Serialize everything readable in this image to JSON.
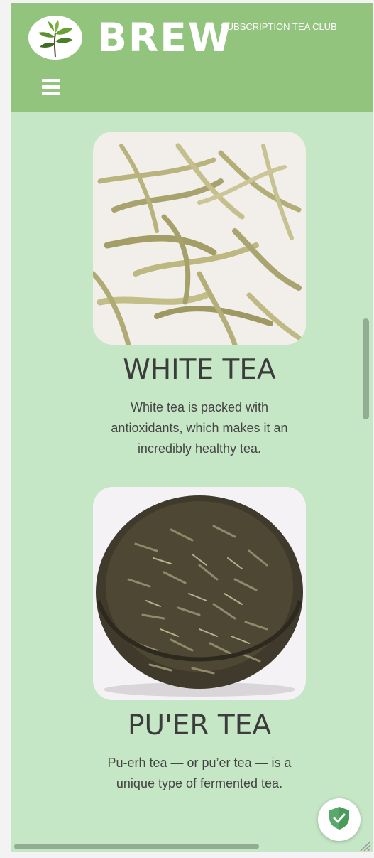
{
  "header": {
    "brand": "BREW",
    "tagline": "SUBSCRIPTION TEA CLUB",
    "logo_icon": "tea-plant-icon",
    "menu_icon": "hamburger-menu-icon"
  },
  "teas": [
    {
      "title": "WHITE TEA",
      "description": "White tea is packed with antioxidants, which makes it an incredibly healthy tea.",
      "image": "white-tea-leaves-image"
    },
    {
      "title": "PU'ER TEA",
      "description": "Pu-erh tea — or pu’er tea — is a unique type of fermented tea.",
      "image": "puer-tea-cake-image"
    }
  ],
  "widgets": {
    "shield_icon": "shield-check-icon"
  },
  "colors": {
    "header": "#93c47d",
    "background": "#c6e7c6",
    "title_text": "#3c3c3c",
    "shield": "#5aa86b"
  }
}
